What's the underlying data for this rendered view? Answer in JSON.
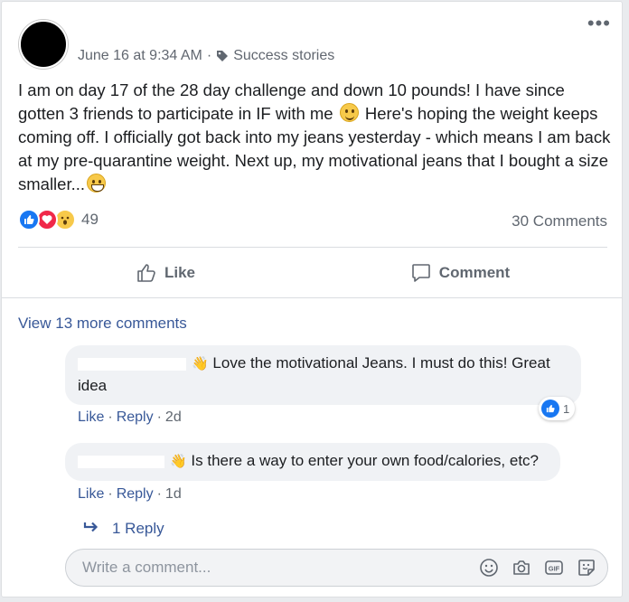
{
  "post": {
    "timestamp": "June 16 at 9:34 AM",
    "separator": "·",
    "topic": "Success stories",
    "text_part1": "I am on day 17 of the 28 day challenge and down 10 pounds! I have since gotten 3 friends to participate in IF with me",
    "text_part2": "Here's hoping the weight keeps coming off. I officially got back into my jeans yesterday - which means I am back at my pre-quarantine weight. Next up, my motivational jeans that I bought a size smaller...",
    "reactions_count": "49",
    "comments_count": "30 Comments"
  },
  "actions": {
    "like_label": "Like",
    "comment_label": "Comment"
  },
  "comments": {
    "view_more": "View 13 more comments",
    "items": [
      {
        "text": "Love the motivational Jeans. I must do this! Great idea",
        "like": "Like",
        "reply": "Reply",
        "sep": "·",
        "time": "2d",
        "reaction_count": "1"
      },
      {
        "text": "Is there a way to enter your own food/calories, etc?",
        "like": "Like",
        "reply": "Reply",
        "sep": "·",
        "time": "1d"
      }
    ],
    "reply_link": "1 Reply"
  },
  "composer": {
    "placeholder": "Write a comment...",
    "icons": [
      "emoji-icon",
      "camera-icon",
      "gif-icon",
      "sticker-icon"
    ]
  },
  "colors": {
    "link": "#385898",
    "like_blue": "#1877f2",
    "love_red": "#f02849"
  }
}
